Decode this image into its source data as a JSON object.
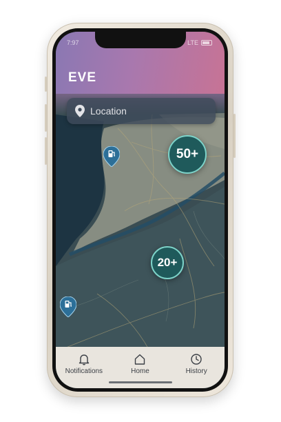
{
  "status_bar": {
    "time": "7:97",
    "network": "LTE"
  },
  "app": {
    "title": "EVE"
  },
  "search": {
    "placeholder": "Location",
    "icon": "location-pin-icon"
  },
  "map": {
    "clusters": [
      {
        "label": "50+"
      },
      {
        "label": "20+"
      }
    ],
    "pins": [
      {
        "icon": "charging-station-icon"
      },
      {
        "icon": "charging-station-icon"
      }
    ]
  },
  "bottom_nav": {
    "items": [
      {
        "label": "Notifications",
        "icon": "bell-icon"
      },
      {
        "label": "Home",
        "icon": "home-icon"
      },
      {
        "label": "History",
        "icon": "clock-icon"
      }
    ]
  },
  "colors": {
    "header_start": "#8a78b3",
    "header_end": "#c77395",
    "cluster_fill": "#1f5a5b",
    "cluster_ring": "#7dd3c9",
    "water": "#1d3442",
    "land": "#8f9588",
    "nav_bg": "#e9e5de"
  }
}
